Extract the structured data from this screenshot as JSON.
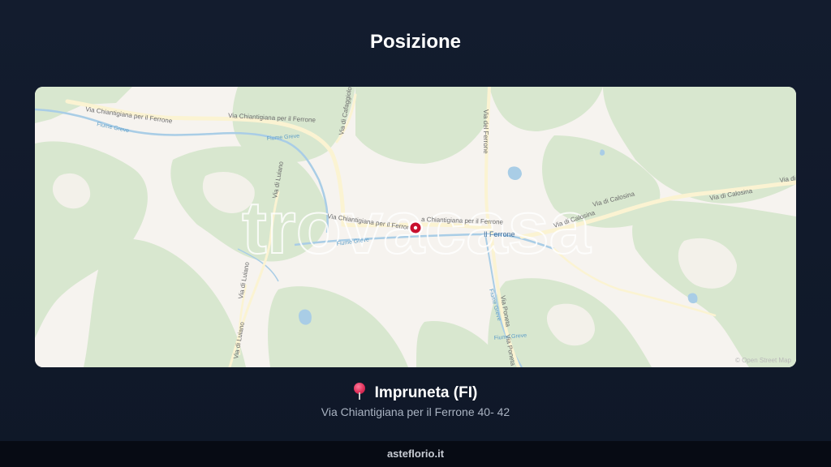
{
  "header": {
    "title": "Posizione"
  },
  "map": {
    "watermark": "trovacasa",
    "attribution": "© Open Street Map",
    "place_labels": [
      "Il Ferrone"
    ],
    "road_labels": [
      "Via Chiantigiana per il Ferrone",
      "Via Chiantigiana per il Ferrone",
      "Via Chiantigiana per il Ferrone",
      "a Chiantigiana per il Ferrone",
      "Via del Ferrone",
      "Via di Cafaggiolo",
      "Via di Luiano",
      "Via di Luiano",
      "Via di Luiano",
      "Via di Calosina",
      "Via di Calosina",
      "Via di Calosina",
      "Via di Calosina",
      "Via Poneta",
      "Via Poneta"
    ],
    "water_labels": [
      "Fiume Greve",
      "Fiume Greve",
      "Fiume Greve",
      "Fiume Greve",
      "Fiume Greve"
    ],
    "colors": {
      "land": "#f6f3ef",
      "forest": "#d8e7cf",
      "water": "#a9cde6",
      "road": "#fbf3d2",
      "marker": "#c8102e"
    },
    "marker_icon": "location-marker-icon"
  },
  "location": {
    "pin_icon": "pushpin-icon",
    "name": "Impruneta (FI)",
    "address": "Via Chiantigiana per il Ferrone 40- 42"
  },
  "footer": {
    "brand": "asteflorio.it"
  }
}
